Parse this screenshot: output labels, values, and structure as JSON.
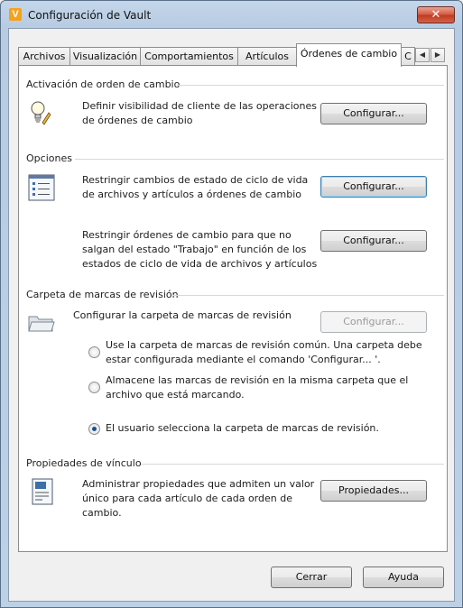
{
  "window": {
    "title": "Configuración de Vault",
    "close_glyph": "✕"
  },
  "tabs": {
    "items": [
      "Archivos",
      "Visualización",
      "Comportamientos",
      "Artículos",
      "Órdenes de cambio",
      "C"
    ],
    "scroll_left": "◀",
    "scroll_right": "▶"
  },
  "activation": {
    "title": "Activación de orden de cambio",
    "description_line1": "Definir visibilidad de cliente de las operaciones",
    "description_line2": "de órdenes de cambio",
    "button": "Configurar..."
  },
  "options": {
    "title": "Opciones",
    "restrict_states_line1": "Restringir cambios de estado de ciclo de vida",
    "restrict_states_line2": "de archivos y artículos a órdenes de cambio",
    "restrict_states_button": "Configurar...",
    "restrict_work_line1": "Restringir órdenes de cambio para que no",
    "restrict_work_line2": "salgan del estado \"Trabajo\" en función de los",
    "restrict_work_line3": "estados de ciclo de vida de archivos y artículos",
    "restrict_work_button": "Configurar..."
  },
  "markup": {
    "title": "Carpeta de marcas de revisión",
    "configure_label": "Configurar la carpeta de marcas de revisión",
    "configure_button": "Configurar...",
    "radio1_line1": "Use la carpeta de marcas de revisión común. Una carpeta debe",
    "radio1_line2": "estar configurada mediante el comando 'Configurar... '.",
    "radio2_line1": "Almacene las marcas de revisión en la misma carpeta que el",
    "radio2_line2": "archivo que está marcando.",
    "radio3_line1": "El usuario selecciona la carpeta de marcas de revisión.",
    "selected": "radio3"
  },
  "link_props": {
    "title": "Propiedades de vínculo",
    "description_line1": "Administrar propiedades que admiten un valor",
    "description_line2": "único para cada artículo de cada orden de",
    "description_line3": "cambio.",
    "button": "Propiedades..."
  },
  "footer": {
    "close_button": "Cerrar",
    "help_button": "Ayuda"
  },
  "colors": {
    "accent": "#3c7fb1",
    "app_icon": "#f4a21c",
    "close": "#c2391e"
  }
}
